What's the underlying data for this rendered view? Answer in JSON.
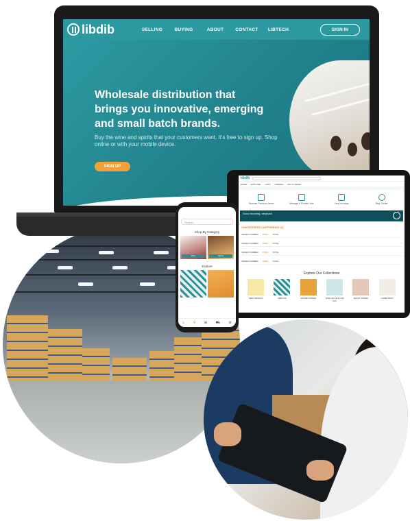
{
  "laptop": {
    "brand": "libdib",
    "nav": [
      "SELLING",
      "BUYING",
      "ABOUT",
      "CONTACT",
      "LIBTECH"
    ],
    "signin_label": "SIGN IN",
    "headline": "Wholesale distribution that brings you innovative, emerging and small batch brands.",
    "subheadline": "Buy the wine and spirits that your customers want. It's free to sign up. Shop online or with your mobile device.",
    "cta_label": "SIGN UP",
    "accent_color": "#2a8f97",
    "cta_color": "#f2a13a"
  },
  "tablet": {
    "brand": "libdib",
    "menu": [
      "HOME",
      "EXPLORE",
      "LISTS",
      "ORDERS",
      "PAY & ORDER"
    ],
    "actions": [
      "Reorder Previous Items",
      "Manage & Create Lists",
      "View Invoices",
      "Rep Center"
    ],
    "greeting": "Good morning, stephani",
    "orders_title": "CHICAGO/DALLAS/PHOENIX (2)",
    "orders": [
      {
        "id": "ORDER NUMBER",
        "status": "OPEN",
        "total": "TOTAL"
      },
      {
        "id": "ORDER NUMBER",
        "status": "OPEN",
        "total": "TOTAL"
      },
      {
        "id": "ORDER NUMBER",
        "status": "OPEN",
        "total": "TOTAL"
      },
      {
        "id": "ORDER NUMBER",
        "status": "OPEN",
        "total": "TOTAL"
      }
    ],
    "collections_title": "Explore Our Collections",
    "collections": [
      "NEW ARRIVALS",
      "LIBPICKS",
      "WOMEN OWNED",
      "WINE VALUE & LOW ALC",
      "BLACK OWNED",
      "LOWER BODY"
    ]
  },
  "phone": {
    "search_placeholder": "Search...",
    "section_category": "Shop By Category",
    "section_explore": "Explore",
    "categories": [
      "Wine",
      "Spirits"
    ],
    "tabs": [
      "home",
      "search",
      "list",
      "cart",
      "account"
    ]
  }
}
